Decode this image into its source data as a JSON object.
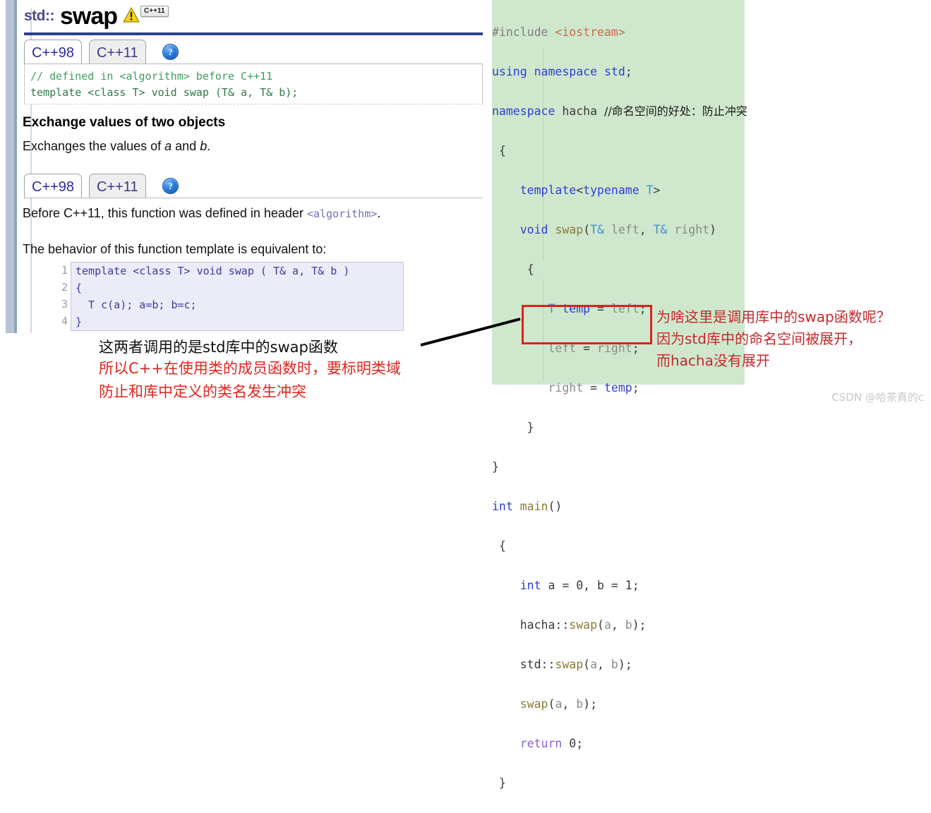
{
  "page": {
    "watermark": "CSDN @哈茶真的c"
  },
  "reference": {
    "title_namespace": "std::",
    "title_name": "swap",
    "badge_label": "C++11",
    "warning_icon": "warning-triangle-icon",
    "tabs_top": [
      {
        "label": "C++98",
        "active": true
      },
      {
        "label": "C++11",
        "active": false
      }
    ],
    "help_label": "?",
    "snippet_comment": "// defined in <algorithm> before C++11",
    "snippet_code": "template <class T> void swap (T& a, T& b);",
    "heading": "Exchange values of two objects",
    "paragraph_pre": "Exchanges the values of ",
    "paragraph_a": "a",
    "paragraph_mid": " and ",
    "paragraph_b": "b",
    "paragraph_end": ".",
    "tabs_bottom": [
      {
        "label": "C++98",
        "active": true
      },
      {
        "label": "C++11",
        "active": false
      }
    ],
    "before_text": "Before C++11, this function was defined in header ",
    "before_header": "<algorithm>",
    "before_period": ".",
    "behavior_text": "The behavior of this function template is equivalent to:",
    "source_lines": [
      {
        "no": "1",
        "code": "template <class T> void swap ( T& a, T& b )"
      },
      {
        "no": "2",
        "code": "{"
      },
      {
        "no": "3",
        "code": "  T c(a); a=b; b=c;"
      },
      {
        "no": "4",
        "code": "}"
      }
    ]
  },
  "editor": {
    "lines": [
      "#include <iostream>",
      "using namespace std;",
      "namespace hacha //命名空间的好处：防止冲突",
      "{",
      "    template<typename T>",
      "    void swap(T& left, T& right)",
      "    {",
      "        T temp = left;",
      "        left = right;",
      "        right = temp;",
      "    }",
      "}",
      "int main()",
      "{",
      "    int a = 0, b = 1;",
      "    hacha::swap(a, b);",
      "    std::swap(a, b);",
      "    swap(a, b);",
      "    return 0;",
      "}"
    ],
    "highlight_box": "std::swap(a, b); / swap(a, b);",
    "colors": {
      "background": "#cfe8cd",
      "highlight_border": "#e01f1f",
      "keyword": "#2f3fd0",
      "type": "#3f8fd0",
      "function": "#8a7a3a",
      "string": "#c96a4f",
      "preprocessor": "#7f7f7f",
      "return_keyword": "#8a5fd0"
    }
  },
  "annotations": {
    "left_black": "这两者调用的是std库中的swap函数",
    "left_red_line1": "所以C++在使用类的成员函数时，要标明类域",
    "left_red_line2": "防止和库中定义的类名发生冲突",
    "right_red_line1": "为啥这里是调用库中的swap函数呢？",
    "right_red_line2": "因为std库中的命名空间被展开，",
    "right_red_line3": "而hacha没有展开",
    "arrow_color": "#000000"
  }
}
